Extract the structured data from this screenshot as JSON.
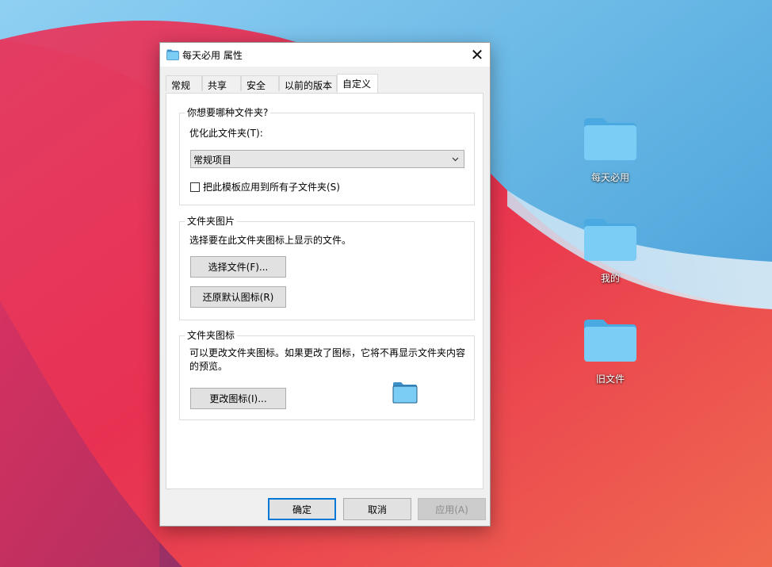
{
  "desktop": {
    "icons": [
      {
        "label": "每天必用"
      },
      {
        "label": "我的"
      },
      {
        "label": "旧文件"
      }
    ]
  },
  "dialog": {
    "title": "每天必用 属性",
    "close_glyph": "✕",
    "tabs": [
      {
        "label": "常规"
      },
      {
        "label": "共享"
      },
      {
        "label": "安全"
      },
      {
        "label": "以前的版本"
      },
      {
        "label": "自定义",
        "active": true
      }
    ],
    "group_folder_type": {
      "title": "你想要哪种文件夹?",
      "optimize_label": "优化此文件夹(T):",
      "optimize_value": "常规项目",
      "apply_subfolders_label": "把此模板应用到所有子文件夹(S)",
      "apply_subfolders_checked": false
    },
    "group_folder_picture": {
      "title": "文件夹图片",
      "description": "选择要在此文件夹图标上显示的文件。",
      "choose_file_button": "选择文件(F)...",
      "restore_default_button": "还原默认图标(R)"
    },
    "group_folder_icon": {
      "title": "文件夹图标",
      "description": "可以更改文件夹图标。如果更改了图标，它将不再显示文件夹内容的预览。",
      "change_icon_button": "更改图标(I)..."
    },
    "footer": {
      "ok_button": "确定",
      "cancel_button": "取消",
      "apply_button": "应用(A)"
    }
  },
  "colors": {
    "accent": "#0078d7",
    "folder_body": "#7ccdf5",
    "folder_tab": "#4aa9e0",
    "wallpaper_sky": "#5aaee0",
    "wallpaper_red": "#e8314f"
  }
}
